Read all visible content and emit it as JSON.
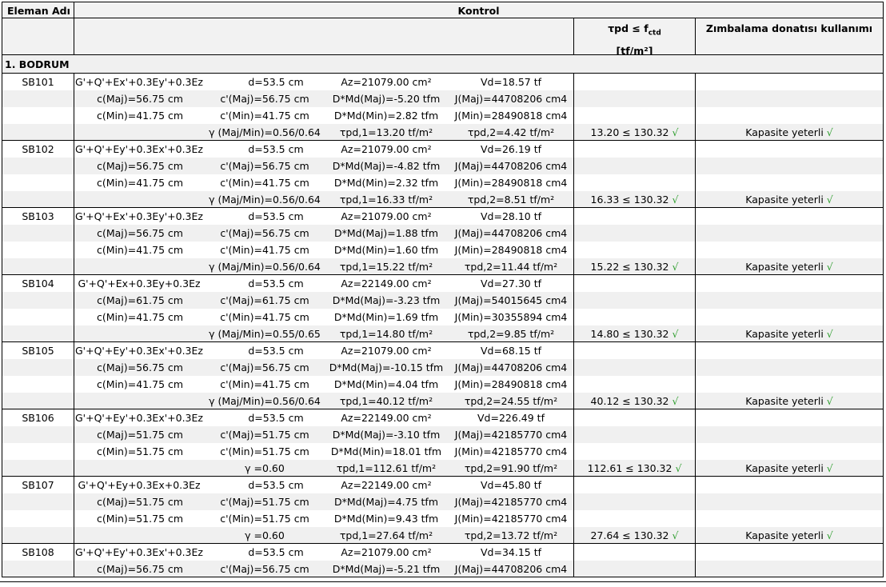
{
  "header": {
    "col_name": "Eleman Adı",
    "col_control": "Kontrol",
    "col_capacity_line1": "τpd ≤ f",
    "col_capacity_sub": "ctd",
    "col_capacity_line2": "[tf/m²]",
    "col_punching": "Zımbalama donatısı kullanımı"
  },
  "section": {
    "title": "1. BODRUM"
  },
  "elements": [
    {
      "name": "SB101",
      "row1": [
        "G'+Q'+Ex'+0.3Ey'+0.3Ez",
        "d=53.5 cm",
        "Az=21079.00 cm²",
        "Vd=18.57 tf"
      ],
      "row2": [
        "c(Maj)=56.75 cm",
        "c'(Maj)=56.75 cm",
        "D*Md(Maj)=-5.20 tfm",
        "J(Maj)=44708206 cm4"
      ],
      "row3": [
        "c(Min)=41.75 cm",
        "c'(Min)=41.75 cm",
        "D*Md(Min)=2.82 tfm",
        "J(Min)=28490818 cm4"
      ],
      "row4": [
        "γ (Maj/Min)=0.56/0.64",
        "τpd,1=13.20 tf/m²",
        "τpd,2=4.42 tf/m²"
      ],
      "check": "13.20 ≤ 130.32",
      "result": "Kapasite yeterli"
    },
    {
      "name": "SB102",
      "row1": [
        "G'+Q'+Ey'+0.3Ex'+0.3Ez",
        "d=53.5 cm",
        "Az=21079.00 cm²",
        "Vd=26.19 tf"
      ],
      "row2": [
        "c(Maj)=56.75 cm",
        "c'(Maj)=56.75 cm",
        "D*Md(Maj)=-4.82 tfm",
        "J(Maj)=44708206 cm4"
      ],
      "row3": [
        "c(Min)=41.75 cm",
        "c'(Min)=41.75 cm",
        "D*Md(Min)=2.32 tfm",
        "J(Min)=28490818 cm4"
      ],
      "row4": [
        "γ (Maj/Min)=0.56/0.64",
        "τpd,1=16.33 tf/m²",
        "τpd,2=8.51 tf/m²"
      ],
      "check": "16.33 ≤ 130.32",
      "result": "Kapasite yeterli"
    },
    {
      "name": "SB103",
      "row1": [
        "G'+Q'+Ex'+0.3Ey'+0.3Ez",
        "d=53.5 cm",
        "Az=21079.00 cm²",
        "Vd=28.10 tf"
      ],
      "row2": [
        "c(Maj)=56.75 cm",
        "c'(Maj)=56.75 cm",
        "D*Md(Maj)=1.88 tfm",
        "J(Maj)=44708206 cm4"
      ],
      "row3": [
        "c(Min)=41.75 cm",
        "c'(Min)=41.75 cm",
        "D*Md(Min)=1.60 tfm",
        "J(Min)=28490818 cm4"
      ],
      "row4": [
        "γ (Maj/Min)=0.56/0.64",
        "τpd,1=15.22 tf/m²",
        "τpd,2=11.44 tf/m²"
      ],
      "check": "15.22 ≤ 130.32",
      "result": "Kapasite yeterli"
    },
    {
      "name": "SB104",
      "row1": [
        "G'+Q'+Ex+0.3Ey+0.3Ez",
        "d=53.5 cm",
        "Az=22149.00 cm²",
        "Vd=27.30 tf"
      ],
      "row2": [
        "c(Maj)=61.75 cm",
        "c'(Maj)=61.75 cm",
        "D*Md(Maj)=-3.23 tfm",
        "J(Maj)=54015645 cm4"
      ],
      "row3": [
        "c(Min)=41.75 cm",
        "c'(Min)=41.75 cm",
        "D*Md(Min)=1.69 tfm",
        "J(Min)=30355894 cm4"
      ],
      "row4": [
        "γ (Maj/Min)=0.55/0.65",
        "τpd,1=14.80 tf/m²",
        "τpd,2=9.85 tf/m²"
      ],
      "check": "14.80 ≤ 130.32",
      "result": "Kapasite yeterli"
    },
    {
      "name": "SB105",
      "row1": [
        "G'+Q'+Ey'+0.3Ex'+0.3Ez",
        "d=53.5 cm",
        "Az=21079.00 cm²",
        "Vd=68.15 tf"
      ],
      "row2": [
        "c(Maj)=56.75 cm",
        "c'(Maj)=56.75 cm",
        "D*Md(Maj)=-10.15 tfm",
        "J(Maj)=44708206 cm4"
      ],
      "row3": [
        "c(Min)=41.75 cm",
        "c'(Min)=41.75 cm",
        "D*Md(Min)=4.04 tfm",
        "J(Min)=28490818 cm4"
      ],
      "row4": [
        "γ (Maj/Min)=0.56/0.64",
        "τpd,1=40.12 tf/m²",
        "τpd,2=24.55 tf/m²"
      ],
      "check": "40.12 ≤ 130.32",
      "result": "Kapasite yeterli"
    },
    {
      "name": "SB106",
      "row1": [
        "G'+Q'+Ey'+0.3Ex'+0.3Ez",
        "d=53.5 cm",
        "Az=22149.00 cm²",
        "Vd=226.49 tf"
      ],
      "row2": [
        "c(Maj)=51.75 cm",
        "c'(Maj)=51.75 cm",
        "D*Md(Maj)=-3.10 tfm",
        "J(Maj)=42185770 cm4"
      ],
      "row3": [
        "c(Min)=51.75 cm",
        "c'(Min)=51.75 cm",
        "D*Md(Min)=18.01 tfm",
        "J(Min)=42185770 cm4"
      ],
      "row4": [
        "γ =0.60",
        "τpd,1=112.61 tf/m²",
        "τpd,2=91.90 tf/m²"
      ],
      "check": "112.61 ≤ 130.32",
      "result": "Kapasite yeterli"
    },
    {
      "name": "SB107",
      "row1": [
        "G'+Q'+Ey+0.3Ex+0.3Ez",
        "d=53.5 cm",
        "Az=22149.00 cm²",
        "Vd=45.80 tf"
      ],
      "row2": [
        "c(Maj)=51.75 cm",
        "c'(Maj)=51.75 cm",
        "D*Md(Maj)=4.75 tfm",
        "J(Maj)=42185770 cm4"
      ],
      "row3": [
        "c(Min)=51.75 cm",
        "c'(Min)=51.75 cm",
        "D*Md(Min)=9.43 tfm",
        "J(Min)=42185770 cm4"
      ],
      "row4": [
        "γ =0.60",
        "τpd,1=27.64 tf/m²",
        "τpd,2=13.72 tf/m²"
      ],
      "check": "27.64 ≤ 130.32",
      "result": "Kapasite yeterli"
    },
    {
      "name": "SB108",
      "row1": [
        "G'+Q'+Ey'+0.3Ex'+0.3Ez",
        "d=53.5 cm",
        "Az=21079.00 cm²",
        "Vd=34.15 tf"
      ],
      "row2": [
        "c(Maj)=56.75 cm",
        "c'(Maj)=56.75 cm",
        "D*Md(Maj)=-5.21 tfm",
        "J(Maj)=44708206 cm4"
      ]
    }
  ],
  "colors": {
    "check_mark": "#2e9e2e",
    "shade": "#f0f0f0",
    "rule": "#000000"
  },
  "icons": {
    "check": "check-mark-icon"
  }
}
